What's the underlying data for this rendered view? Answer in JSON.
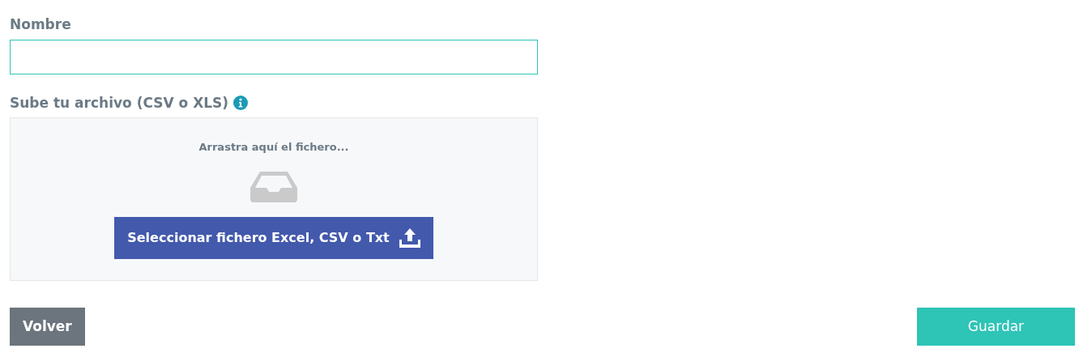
{
  "name_field": {
    "label": "Nombre"
  },
  "upload": {
    "label": "Sube tu archivo (CSV o XLS)",
    "drop_text": "Arrastra aquí el fichero...",
    "button": "Seleccionar fichero Excel, CSV o Txt"
  },
  "buttons": [
    {
      "label": "Volver",
      "kind": "back"
    },
    {
      "label": "Guardar",
      "kind": "save"
    }
  ]
}
